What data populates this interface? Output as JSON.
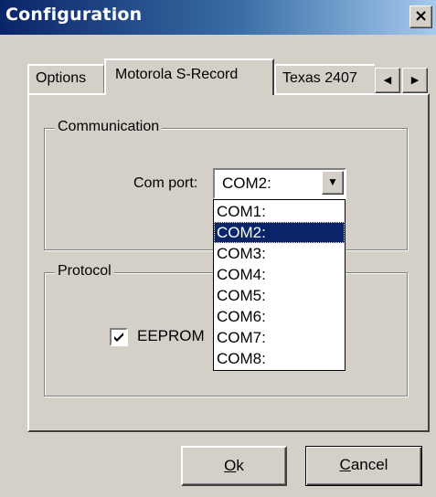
{
  "window": {
    "title": "Configuration",
    "close_glyph": "×"
  },
  "tabs": [
    {
      "label": "Options",
      "active": false
    },
    {
      "label": "Motorola S-Record",
      "active": true
    },
    {
      "label": "Texas 2407",
      "active": false
    }
  ],
  "tab_scroll": {
    "left_glyph": "◀",
    "right_glyph": "▶"
  },
  "communication": {
    "group_label": "Communication",
    "com_port_label": "Com port:",
    "com_port_value": "COM2:",
    "dropdown_glyph": "▼",
    "options": [
      "COM1:",
      "COM2:",
      "COM3:",
      "COM4:",
      "COM5:",
      "COM6:",
      "COM7:",
      "COM8:"
    ],
    "selected_index": 1
  },
  "protocol": {
    "group_label": "Protocol",
    "eeprom_label": "EEPROM",
    "eeprom_checked": true
  },
  "buttons": {
    "ok_mnemonic": "O",
    "ok_rest": "k",
    "cancel_mnemonic": "C",
    "cancel_rest": "ancel"
  },
  "colors": {
    "face": "#d4d0c8",
    "selection": "#0a246a",
    "title_start": "#0a246a",
    "title_end": "#a6caf0"
  }
}
